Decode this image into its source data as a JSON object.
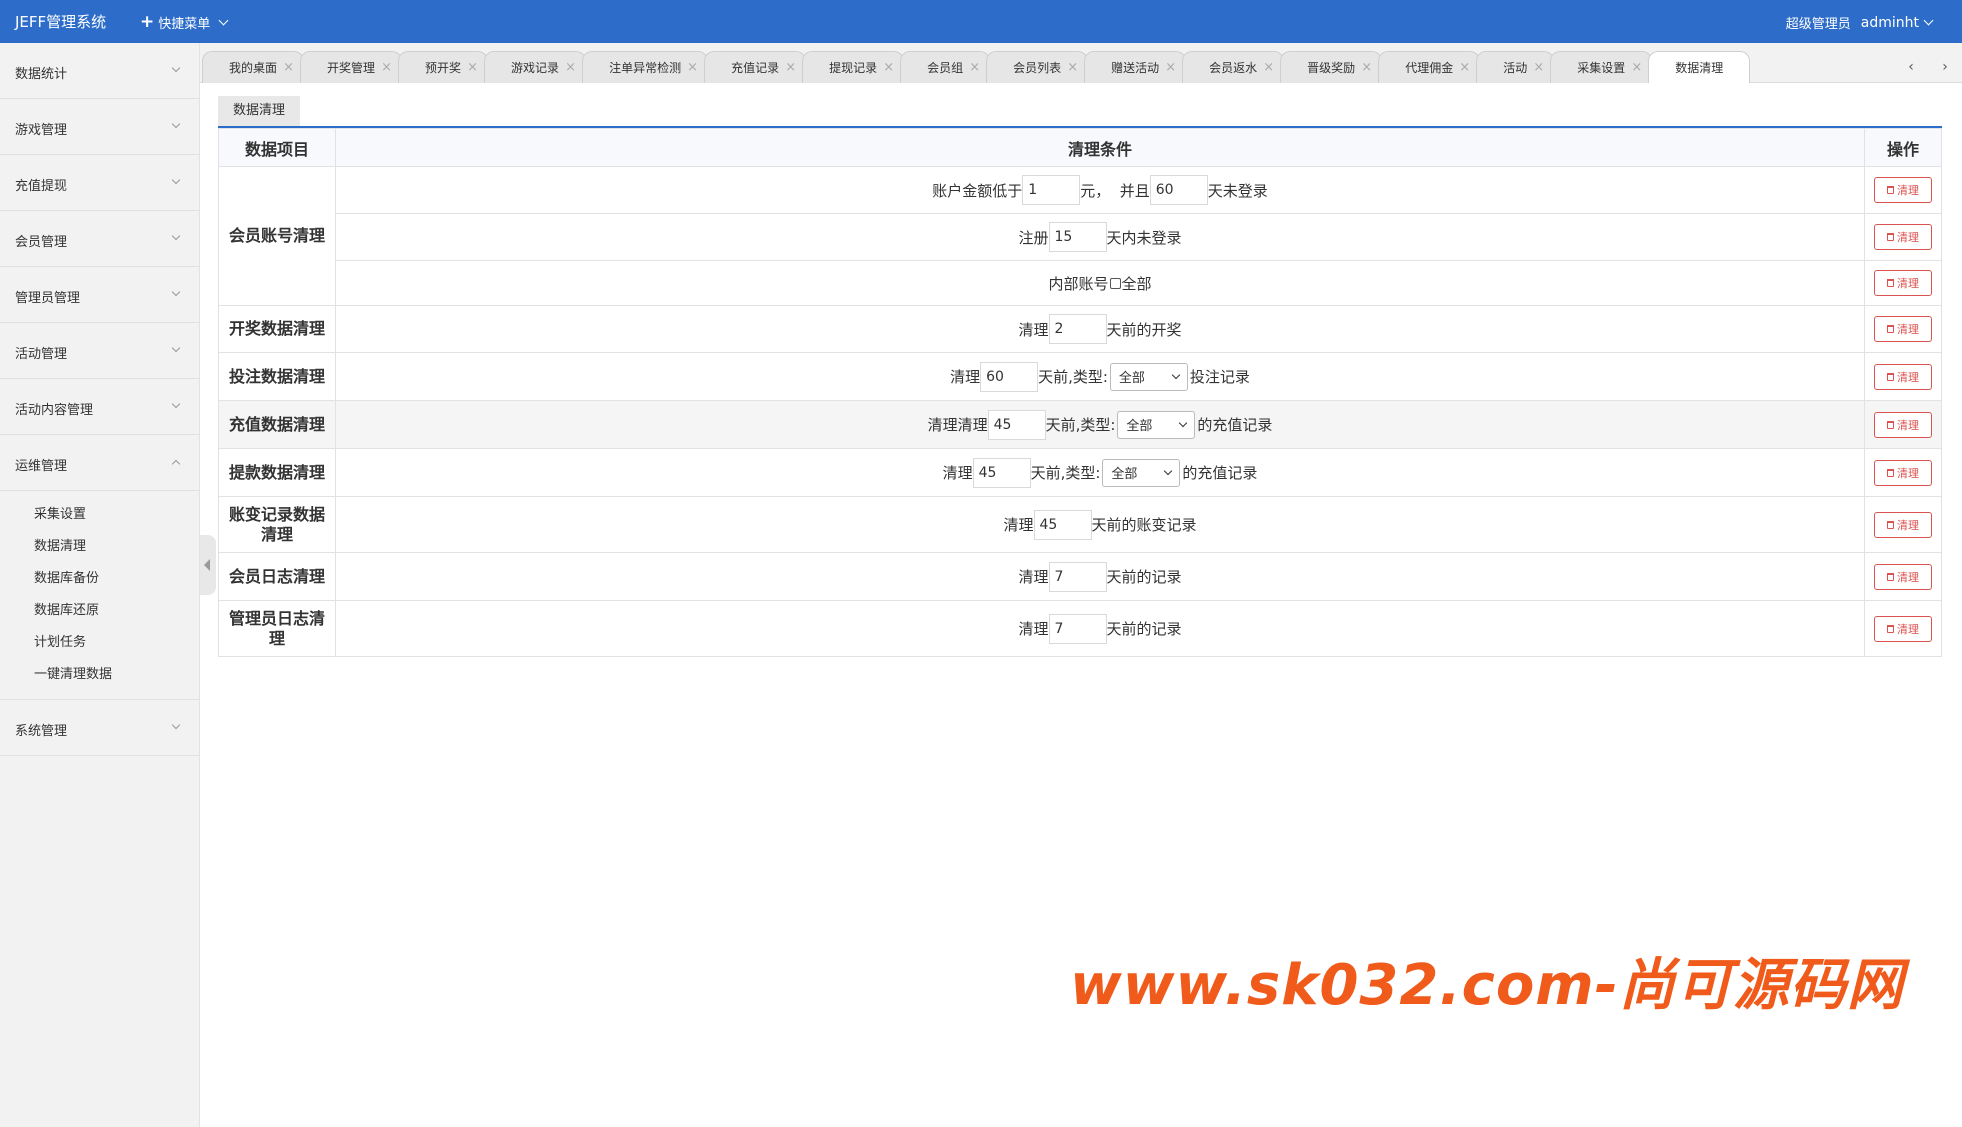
{
  "header": {
    "brand": "JEFF管理系统",
    "quick_menu": "快捷菜单",
    "role": "超级管理员",
    "username": "adminht"
  },
  "sidebar": {
    "items": [
      {
        "label": "数据统计"
      },
      {
        "label": "游戏管理"
      },
      {
        "label": "充值提现"
      },
      {
        "label": "会员管理"
      },
      {
        "label": "管理员管理"
      },
      {
        "label": "活动管理"
      },
      {
        "label": "活动内容管理"
      },
      {
        "label": "运维管理"
      },
      {
        "label": "系统管理"
      }
    ],
    "ops_sub": [
      "采集设置",
      "数据清理",
      "数据库备份",
      "数据库还原",
      "计划任务",
      "一键清理数据"
    ]
  },
  "tabs": [
    "我的桌面",
    "开奖管理",
    "预开奖",
    "游戏记录",
    "注单异常检测",
    "充值记录",
    "提现记录",
    "会员组",
    "会员列表",
    "赠送活动",
    "会员返水",
    "晋级奖励",
    "代理佣金",
    "活动",
    "采集设置",
    "数据清理"
  ],
  "tab_nav": {
    "prev": "‹",
    "next": "›"
  },
  "page": {
    "subtab": "数据清理",
    "col_item": "数据项目",
    "col_cond": "清理条件",
    "col_op": "操作",
    "clean_label": "清理"
  },
  "rows": {
    "account": {
      "label": "会员账号清理",
      "r1": {
        "pre": "账户金额低于",
        "v1": "1",
        "mid": "元，  并且",
        "v2": "60",
        "post": "天未登录"
      },
      "r2": {
        "pre": "注册",
        "v1": "15",
        "post": "天内未登录"
      },
      "r3": {
        "pre": "内部账号",
        "post": "全部"
      }
    },
    "lottery": {
      "label": "开奖数据清理",
      "pre": "清理",
      "v1": "2",
      "post": "天前的开奖"
    },
    "bet": {
      "label": "投注数据清理",
      "pre": "清理",
      "v1": "60",
      "mid": "天前,类型:",
      "sel": "全部",
      "post": "投注记录"
    },
    "recharge": {
      "label": "充值数据清理",
      "pre": "清理清理",
      "v1": "45",
      "mid": "天前,类型:",
      "sel": "全部",
      "post": "的充值记录"
    },
    "withdraw": {
      "label": "提款数据清理",
      "pre": "清理",
      "v1": "45",
      "mid": "天前,类型:",
      "sel": "全部",
      "post": "的充值记录"
    },
    "ledger": {
      "label": "账变记录数据清理",
      "pre": "清理",
      "v1": "45",
      "post": "天前的账变记录"
    },
    "member_log": {
      "label": "会员日志清理",
      "pre": "清理",
      "v1": "7",
      "post": "天前的记录"
    },
    "admin_log": {
      "label": "管理员日志清理",
      "pre": "清理",
      "v1": "7",
      "post": "天前的记录"
    }
  },
  "watermark": "www.sk032.com-尚可源码网",
  "colors": {
    "primary": "#2d6dc9",
    "danger": "#d9534f",
    "watermark": "#f05a1a"
  }
}
